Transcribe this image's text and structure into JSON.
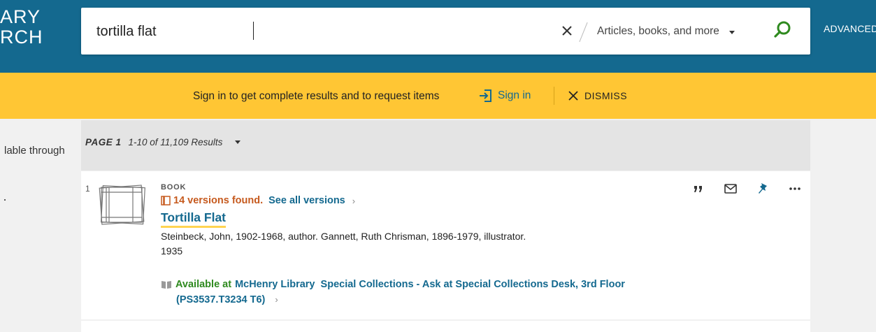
{
  "header": {
    "brand_text": "ARY\nRCH",
    "search_query": "tortilla flat",
    "scope_label": "Articles, books, and more",
    "advanced_label": "ADVANCED"
  },
  "banner": {
    "message": "Sign in to get complete results and to request items",
    "signin_label": "Sign in",
    "dismiss_label": "DISMISS"
  },
  "facets": {
    "fragment_text": "lable through"
  },
  "results": {
    "page_label": "PAGE 1",
    "count_text": "1-10 of 11,109 Results"
  },
  "result": {
    "index": "1",
    "type": "BOOK",
    "versions_text": "14 versions found.",
    "see_all_label": "See all versions",
    "title": "Tortilla Flat",
    "authors": "Steinbeck, John, 1902-1968, author. Gannett, Ruth Chrisman, 1896-1979, illustrator.",
    "year": "1935",
    "availability_status": "Available at",
    "availability_location": "McHenry Library  Special Collections - Ask at Special Collections Desk, 3rd Floor",
    "call_number": "(PS3537.T3234 T6)"
  },
  "colors": {
    "header_bg": "#14698f",
    "banner_bg": "#ffc634",
    "link": "#14698f",
    "versions": "#c65a1e",
    "available": "#2f8a1f"
  }
}
